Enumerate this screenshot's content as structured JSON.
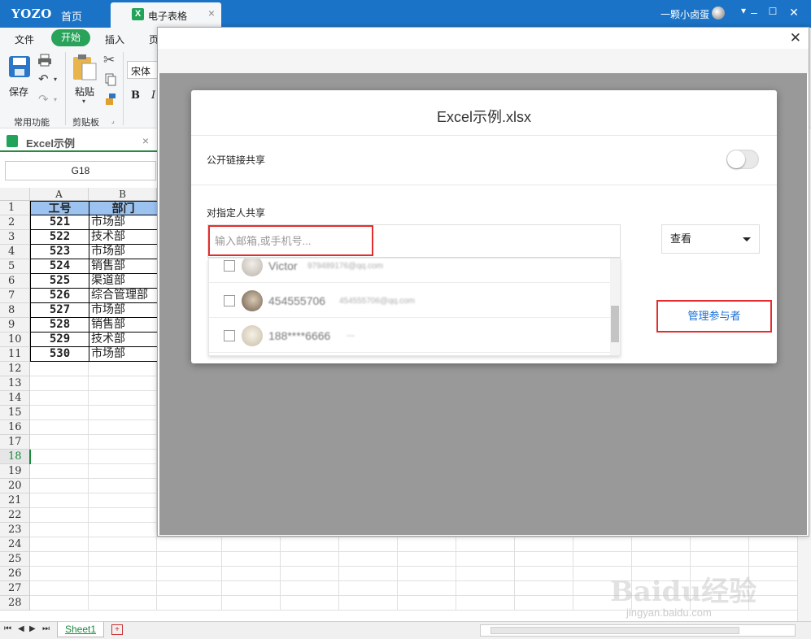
{
  "titlebar": {
    "logo": "YOZO",
    "home_tab": "首页",
    "doc_tab": "电子表格",
    "doc_tab_icon": "X",
    "user_name": "一颗小卤蛋",
    "colors": {
      "bar": "#1a73c7",
      "accent": "#29a35a"
    }
  },
  "menu": {
    "items": [
      "文件",
      "开始",
      "插入",
      "页"
    ],
    "active": "开始"
  },
  "ribbon": {
    "save_label": "保存",
    "paste_label": "粘贴",
    "font_name": "宋体",
    "bold": "B",
    "italic": "I",
    "group_common": "常用功能",
    "group_clipboard": "剪贴板"
  },
  "file_tab": {
    "label": "Excel示例"
  },
  "name_box": "G18",
  "sheet": {
    "columns": [
      "A",
      "B"
    ],
    "headers": [
      "工号",
      "部门"
    ],
    "rows": [
      [
        "521",
        "市场部"
      ],
      [
        "522",
        "技术部"
      ],
      [
        "523",
        "市场部"
      ],
      [
        "524",
        "销售部"
      ],
      [
        "525",
        "渠道部"
      ],
      [
        "526",
        "综合管理部"
      ],
      [
        "527",
        "市场部"
      ],
      [
        "528",
        "销售部"
      ],
      [
        "529",
        "技术部"
      ],
      [
        "530",
        "市场部"
      ]
    ],
    "row_count": 28,
    "selected_row": 18,
    "tabs": [
      "Sheet1"
    ]
  },
  "share_dialog": {
    "title": "Excel示例.xlsx",
    "public_link_label": "公开链接共享",
    "public_link_enabled": false,
    "specific_label": "对指定人共享",
    "input_placeholder": "输入邮箱,或手机号...",
    "permission": "查看",
    "contacts": [
      {
        "name": "Victor",
        "email": "979489176@qq.com"
      },
      {
        "name": "454555706",
        "email": "454555706@qq.com"
      },
      {
        "name": "188****6666",
        "email": "---"
      }
    ],
    "manage_button": "管理参与者"
  },
  "watermark": {
    "main": "Baidu经验",
    "sub": "jingyan.baidu.com"
  }
}
